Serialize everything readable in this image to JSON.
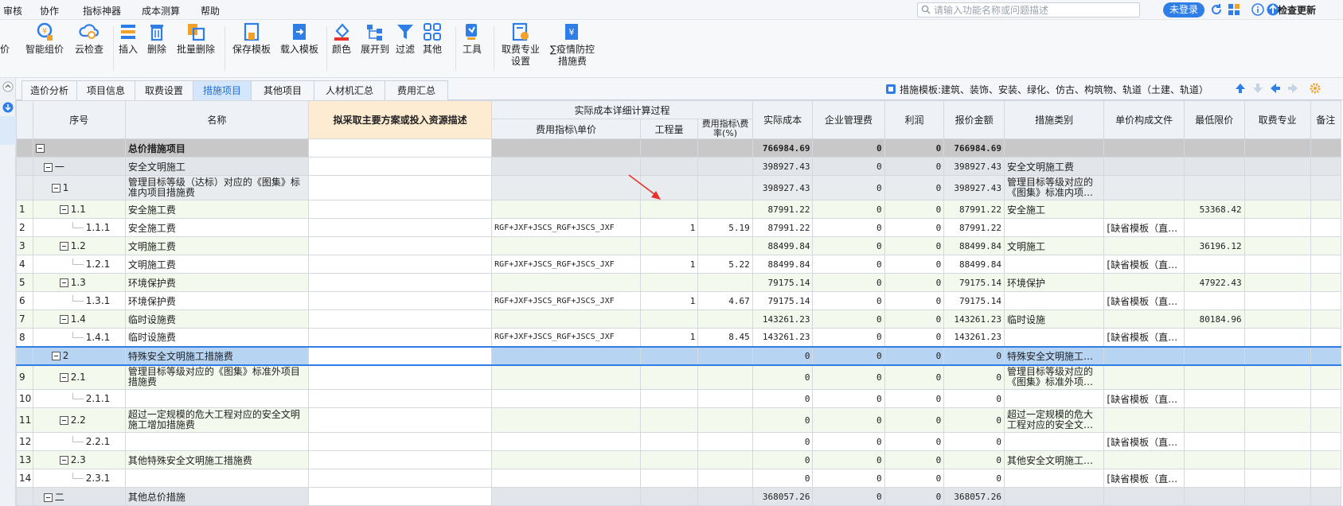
{
  "menubar": {
    "items": [
      "审核",
      "协作",
      "指标神器",
      "成本测算",
      "帮助"
    ],
    "search_placeholder": "请输入功能名称或问题描述",
    "login_label": "未登录",
    "check_update_label": "检查更新"
  },
  "toolbar": {
    "partial_label": "价",
    "buttons": [
      {
        "label": "智能组价",
        "icon": "smart-price-icon"
      },
      {
        "label": "云检查",
        "icon": "cloud-check-icon"
      },
      {
        "label": "插入",
        "icon": "insert-icon"
      },
      {
        "label": "删除",
        "icon": "delete-icon"
      },
      {
        "label": "批量删除",
        "icon": "batch-delete-icon"
      },
      {
        "label": "保存模板",
        "icon": "save-template-icon"
      },
      {
        "label": "载入模板",
        "icon": "load-template-icon"
      },
      {
        "label": "颜色",
        "icon": "color-icon"
      },
      {
        "label": "展开到",
        "icon": "expand-icon"
      },
      {
        "label": "过滤",
        "icon": "filter-icon"
      },
      {
        "label": "其他",
        "icon": "other-icon"
      },
      {
        "label": "工具",
        "icon": "tools-icon"
      },
      {
        "label": "取费专业",
        "label2": "设置",
        "icon": "fee-setting-icon"
      },
      {
        "label": "∑疫情防控",
        "label2": "措施费",
        "icon": "epidemic-icon"
      }
    ]
  },
  "tabs": [
    "造价分析",
    "项目信息",
    "取费设置",
    "措施项目",
    "其他项目",
    "人材机汇总",
    "费用汇总"
  ],
  "active_tab": "措施项目",
  "template_label": "措施模板:建筑、装饰、安装、绿化、仿古、构筑物、轨道（土建、轨道）",
  "grid": {
    "headers": {
      "seq": "序号",
      "name": "名称",
      "desc": "拟采取主要方案或投入资源描述",
      "detail_group": "实际成本详细计算过程",
      "fee_index": "费用指标\\单价",
      "qty": "工程量",
      "rate": "费用指标\\费率(%)",
      "actual": "实际成本",
      "mgmt": "企业管理费",
      "profit": "利润",
      "quote": "报价金额",
      "category": "措施类别",
      "unit_doc": "单价构成文件",
      "min_price": "最低限价",
      "fee_major": "取费专业",
      "remark": "备注"
    },
    "rows": [
      {
        "rn": "",
        "code": "",
        "name": "总价措施项目",
        "formula": "",
        "qty": "",
        "rate": "",
        "actual": "766984.69",
        "mgmt": "0",
        "profit": "0",
        "quote": "766984.69",
        "category": "",
        "unit_doc": "",
        "min_price": ""
      },
      {
        "rn": "",
        "code": "一",
        "name": "安全文明施工",
        "formula": "",
        "qty": "",
        "rate": "",
        "actual": "398927.43",
        "mgmt": "0",
        "profit": "0",
        "quote": "398927.43",
        "category": "安全文明施工费",
        "unit_doc": "",
        "min_price": ""
      },
      {
        "rn": "",
        "code": "1",
        "name": "管理目标等级（达标）对应的《图集》标准内项目措施费",
        "formula": "",
        "qty": "",
        "rate": "",
        "actual": "398927.43",
        "mgmt": "0",
        "profit": "0",
        "quote": "398927.43",
        "category": "管理目标等级对应的《图集》标准内项…",
        "unit_doc": "",
        "min_price": ""
      },
      {
        "rn": "1",
        "code": "1.1",
        "name": "安全施工费",
        "formula": "",
        "qty": "",
        "rate": "",
        "actual": "87991.22",
        "mgmt": "0",
        "profit": "0",
        "quote": "87991.22",
        "category": "安全施工",
        "unit_doc": "",
        "min_price": "53368.42"
      },
      {
        "rn": "2",
        "code": "1.1.1",
        "name": "安全施工费",
        "formula": "RGF+JXF+JSCS_RGF+JSCS_JXF",
        "qty": "1",
        "rate": "5.19",
        "actual": "87991.22",
        "mgmt": "0",
        "profit": "0",
        "quote": "87991.22",
        "category": "",
        "unit_doc": "[缺省模板（直…",
        "min_price": ""
      },
      {
        "rn": "3",
        "code": "1.2",
        "name": "文明施工费",
        "formula": "",
        "qty": "",
        "rate": "",
        "actual": "88499.84",
        "mgmt": "0",
        "profit": "0",
        "quote": "88499.84",
        "category": "文明施工",
        "unit_doc": "",
        "min_price": "36196.12"
      },
      {
        "rn": "4",
        "code": "1.2.1",
        "name": "文明施工费",
        "formula": "RGF+JXF+JSCS_RGF+JSCS_JXF",
        "qty": "1",
        "rate": "5.22",
        "actual": "88499.84",
        "mgmt": "0",
        "profit": "0",
        "quote": "88499.84",
        "category": "",
        "unit_doc": "[缺省模板（直…",
        "min_price": ""
      },
      {
        "rn": "5",
        "code": "1.3",
        "name": "环境保护费",
        "formula": "",
        "qty": "",
        "rate": "",
        "actual": "79175.14",
        "mgmt": "0",
        "profit": "0",
        "quote": "79175.14",
        "category": "环境保护",
        "unit_doc": "",
        "min_price": "47922.43"
      },
      {
        "rn": "6",
        "code": "1.3.1",
        "name": "环境保护费",
        "formula": "RGF+JXF+JSCS_RGF+JSCS_JXF",
        "qty": "1",
        "rate": "4.67",
        "actual": "79175.14",
        "mgmt": "0",
        "profit": "0",
        "quote": "79175.14",
        "category": "",
        "unit_doc": "[缺省模板（直…",
        "min_price": ""
      },
      {
        "rn": "7",
        "code": "1.4",
        "name": "临时设施费",
        "formula": "",
        "qty": "",
        "rate": "",
        "actual": "143261.23",
        "mgmt": "0",
        "profit": "0",
        "quote": "143261.23",
        "category": "临时设施",
        "unit_doc": "",
        "min_price": "80184.96"
      },
      {
        "rn": "8",
        "code": "1.4.1",
        "name": "临时设施费",
        "formula": "RGF+JXF+JSCS_RGF+JSCS_JXF",
        "qty": "1",
        "rate": "8.45",
        "actual": "143261.23",
        "mgmt": "0",
        "profit": "0",
        "quote": "143261.23",
        "category": "",
        "unit_doc": "[缺省模板（直…",
        "min_price": ""
      },
      {
        "rn": "",
        "code": "2",
        "name": "特殊安全文明施工措施费",
        "formula": "",
        "qty": "",
        "rate": "",
        "actual": "0",
        "mgmt": "0",
        "profit": "0",
        "quote": "0",
        "category": "特殊安全文明施工…",
        "unit_doc": "",
        "min_price": ""
      },
      {
        "rn": "9",
        "code": "2.1",
        "name": "管理目标等级对应的《图集》标准外项目措施费",
        "formula": "",
        "qty": "",
        "rate": "",
        "actual": "0",
        "mgmt": "0",
        "profit": "0",
        "quote": "0",
        "category": "管理目标等级对应的《图集》标准外项…",
        "unit_doc": "",
        "min_price": ""
      },
      {
        "rn": "10",
        "code": "2.1.1",
        "name": "",
        "formula": "",
        "qty": "",
        "rate": "",
        "actual": "0",
        "mgmt": "0",
        "profit": "0",
        "quote": "0",
        "category": "",
        "unit_doc": "[缺省模板（直…",
        "min_price": ""
      },
      {
        "rn": "11",
        "code": "2.2",
        "name": "超过一定规模的危大工程对应的安全文明施工增加措施费",
        "formula": "",
        "qty": "",
        "rate": "",
        "actual": "0",
        "mgmt": "0",
        "profit": "0",
        "quote": "0",
        "category": "超过一定规模的危大工程对应的安全文…",
        "unit_doc": "",
        "min_price": ""
      },
      {
        "rn": "12",
        "code": "2.2.1",
        "name": "",
        "formula": "",
        "qty": "",
        "rate": "",
        "actual": "0",
        "mgmt": "0",
        "profit": "0",
        "quote": "0",
        "category": "",
        "unit_doc": "[缺省模板（直…",
        "min_price": ""
      },
      {
        "rn": "13",
        "code": "2.3",
        "name": "其他特殊安全文明施工措施费",
        "formula": "",
        "qty": "",
        "rate": "",
        "actual": "0",
        "mgmt": "0",
        "profit": "0",
        "quote": "0",
        "category": "其他安全文明施工…",
        "unit_doc": "",
        "min_price": ""
      },
      {
        "rn": "14",
        "code": "2.3.1",
        "name": "",
        "formula": "",
        "qty": "",
        "rate": "",
        "actual": "0",
        "mgmt": "0",
        "profit": "0",
        "quote": "0",
        "category": "",
        "unit_doc": "[缺省模板（直…",
        "min_price": ""
      },
      {
        "rn": "",
        "code": "二",
        "name": "其他总价措施",
        "formula": "",
        "qty": "",
        "rate": "",
        "actual": "368057.26",
        "mgmt": "0",
        "profit": "0",
        "quote": "368057.26",
        "category": "",
        "unit_doc": "",
        "min_price": ""
      }
    ]
  },
  "colors": {
    "accent": "#2f7ee8",
    "active_tab_bg": "#d3e6fb",
    "highlight_header": "#fdebd2",
    "selected_row": "#b7d4f3",
    "annotation_arrow": "#e8312a"
  }
}
